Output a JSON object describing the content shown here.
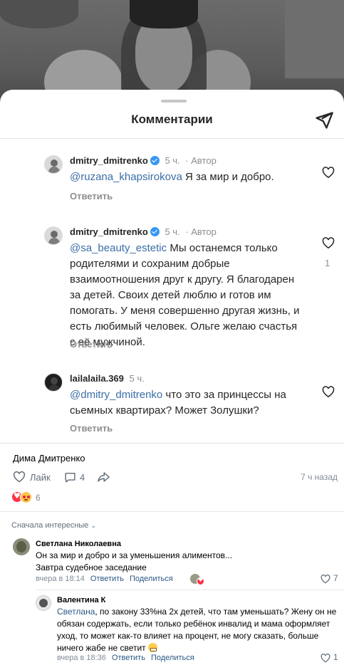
{
  "sheet": {
    "title": "Комментарии",
    "icons": {
      "share": "send-icon",
      "like": "heart-outline-icon"
    }
  },
  "ig_comments": [
    {
      "user": "dmitry_dmitrenko",
      "verified": true,
      "time": "5 ч.",
      "author_badge": "· Автор",
      "mention": "@ruzana_khapsirokova",
      "text": " Я за мир и добро.",
      "reply": "Ответить",
      "likes": ""
    },
    {
      "user": "dmitry_dmitrenko",
      "verified": true,
      "time": "5 ч.",
      "author_badge": "· Автор",
      "mention": "@sa_beauty_estetic",
      "text": " Мы останемся только родителями и сохраним добрые взаимоотношения друг к другу. Я благодарен за детей. Своих детей люблю и готов им помогать. У меня совершенно другая жизнь, и есть любимый человек. Ольге желаю счастья с её мужчиной.",
      "reply": "Ответить",
      "likes": "1"
    },
    {
      "user": "lailalaila.369",
      "verified": false,
      "time": "5 ч.",
      "author_badge": "",
      "mention": "@dmitry_dmitrenko",
      "text": " что это за принцессы на сьемных квартирах? Может Золушки?",
      "reply": "Ответить",
      "likes": ""
    }
  ],
  "post": {
    "author": "Дима Дмитренко",
    "like_label": "Лайк",
    "comments_count": "4",
    "time": "7 ч назад",
    "reactions_count": "6",
    "icons": [
      "like-icon",
      "comment-icon",
      "share-icon"
    ]
  },
  "sort_label": "Сначала интересные",
  "vk_comments": [
    {
      "name": "Светлана Николаевна",
      "line1": "Он за мир и добро и за уменьшения алиментов...",
      "line2": "Завтра судебное заседание",
      "date": "вчера в 18:14",
      "reply": "Ответить",
      "share": "Поделиться",
      "likes": "7"
    },
    {
      "name": "Валентина К",
      "mention": "Светлана",
      "text": ", по закону 33%на 2х детей, что там уменьшать? Жену он не обязан содержать, если только ребёнок инвалид и мама оформляет уход, то может как-то влияет на процент, не могу сказать, больше ничего жабе не светит",
      "date": "вчера в 18:36",
      "reply": "Ответить",
      "share": "Поделиться",
      "likes": "1"
    }
  ]
}
